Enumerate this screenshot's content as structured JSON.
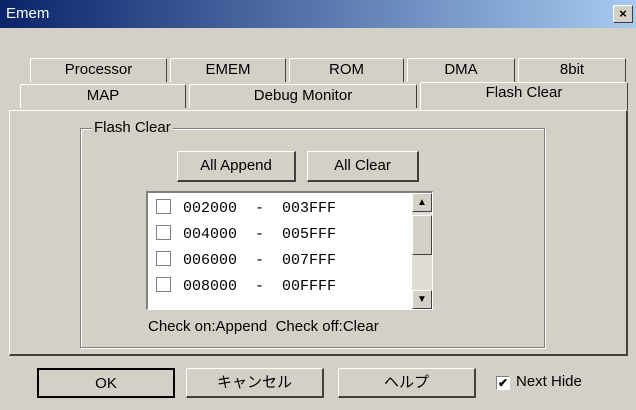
{
  "window": {
    "title": "Emem",
    "close_glyph": "×"
  },
  "tabs_row1": [
    "Processor",
    "EMEM",
    "ROM",
    "DMA",
    "8bit"
  ],
  "tabs_row2": [
    "MAP",
    "Debug Monitor",
    "Flash Clear"
  ],
  "active_tab": "Flash Clear",
  "group": {
    "label": "Flash Clear",
    "append_button": "All Append",
    "clear_button": "All Clear",
    "hint": "Check on:Append  Check off:Clear"
  },
  "ranges": [
    {
      "text": "002000  -  003FFF",
      "checked": false
    },
    {
      "text": "004000  -  005FFF",
      "checked": false
    },
    {
      "text": "006000  -  007FFF",
      "checked": false
    },
    {
      "text": "008000  -  00FFFF",
      "checked": false
    }
  ],
  "footer": {
    "ok": "OK",
    "cancel": "キャンセル",
    "help": "ヘルプ",
    "next_hide_label": "Next Hide",
    "next_hide_checked": true
  },
  "colors": {
    "title_start": "#0a246a",
    "title_end": "#a6caf0",
    "face": "#d4d0c8"
  }
}
